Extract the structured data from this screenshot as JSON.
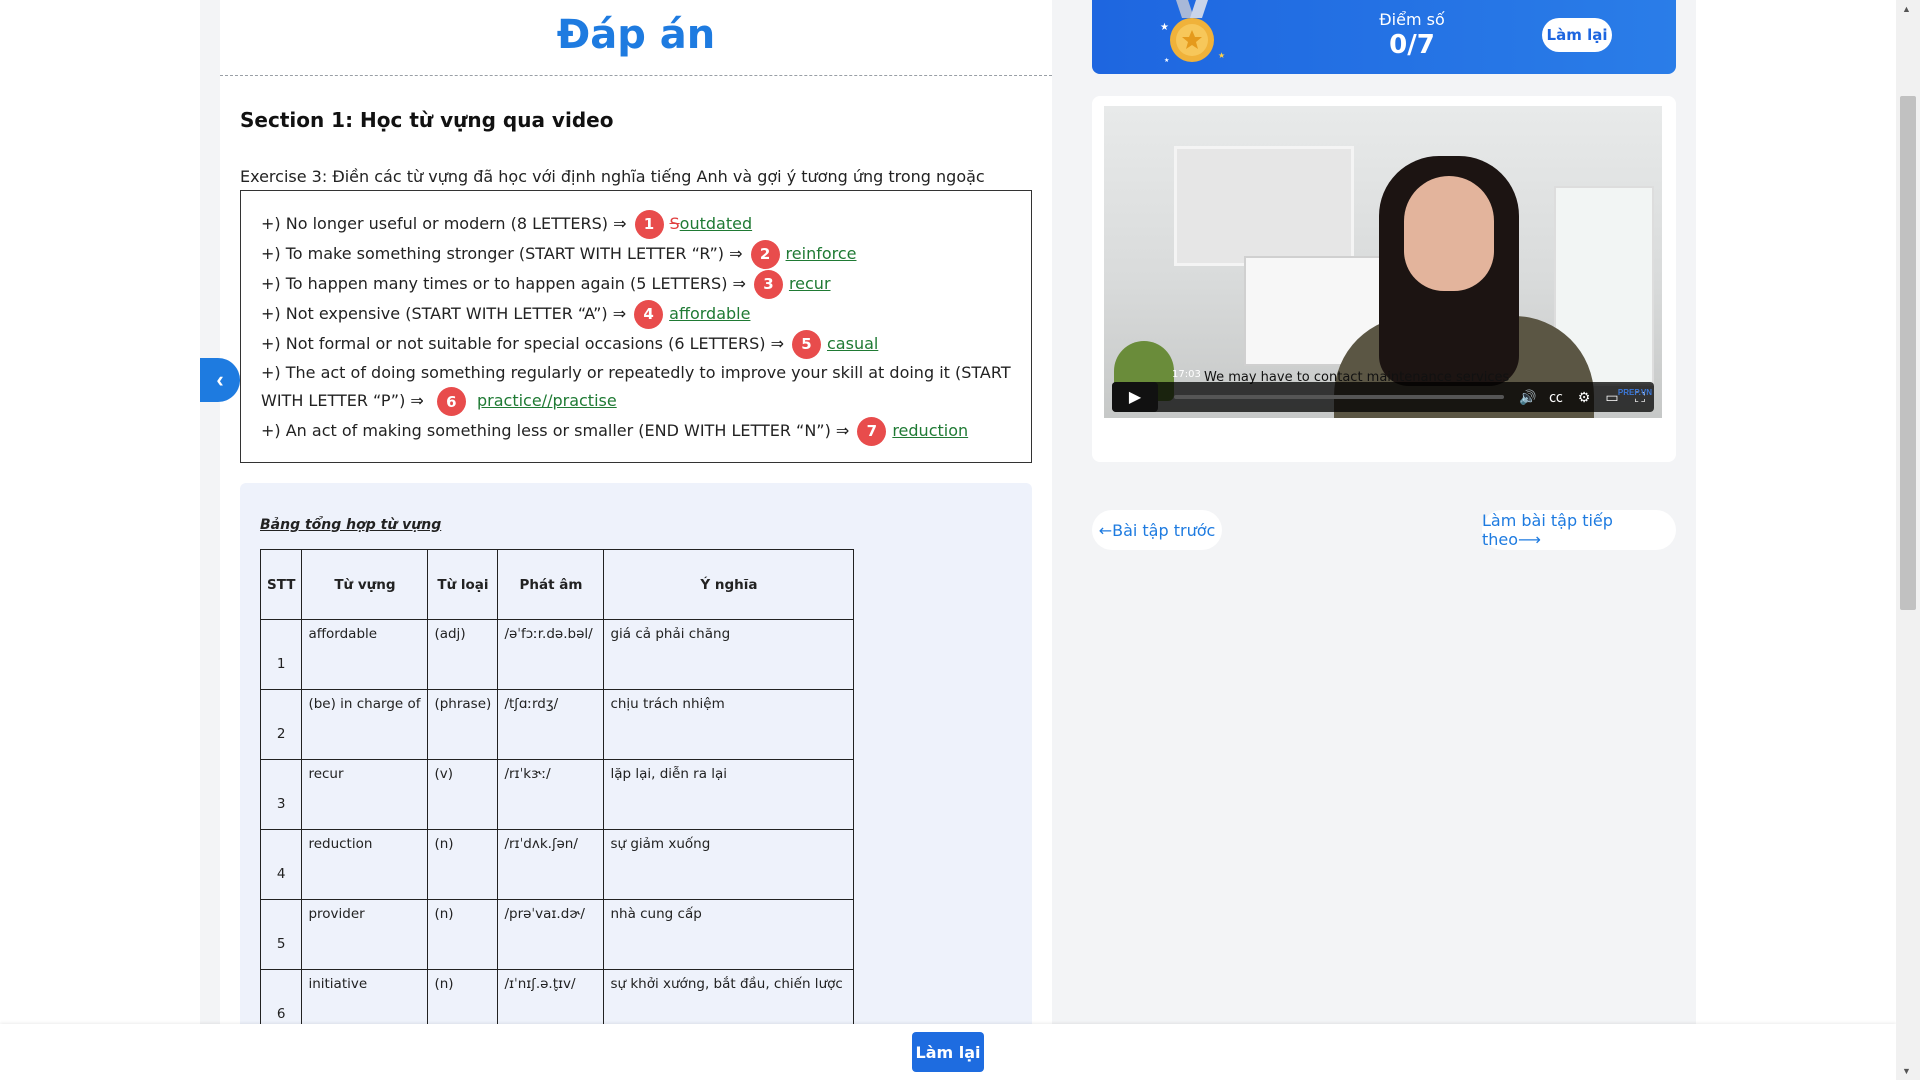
{
  "header": {
    "title": "Đáp án"
  },
  "section": {
    "heading": "Section 1: Học từ vựng qua video",
    "exercise_title": "Exercise 3: Điền các từ vựng đã học với định nghĩa tiếng Anh và gợi ý tương ứng trong ngoặc"
  },
  "questions": [
    {
      "text": "+) No longer useful or modern (8 LETTERS) ⇒",
      "number": "1",
      "wrong": "S",
      "answer": "outdated"
    },
    {
      "text": "+) To make something stronger (START WITH LETTER “R”) ⇒",
      "number": "2",
      "answer": "reinforce"
    },
    {
      "text": "+) To happen many times or to happen again (5 LETTERS) ⇒",
      "number": "3",
      "answer": "recur"
    },
    {
      "text": "+) Not expensive (START WITH LETTER “A”) ⇒",
      "number": "4",
      "answer": "affordable"
    },
    {
      "text": "+) Not formal or not suitable for special occasions (6 LETTERS) ⇒",
      "number": "5",
      "answer": "casual"
    },
    {
      "text": "+) The act of doing something regularly or repeatedly to improve your skill at doing it (START WITH LETTER “P”) ⇒",
      "number": "6",
      "answer": "practice//practise"
    },
    {
      "text": "+) An act of making something less or smaller (END WITH LETTER “N”) ⇒",
      "number": "7",
      "answer": "reduction"
    }
  ],
  "vocab": {
    "title": "Bảng tổng hợp từ vựng",
    "headers": [
      "STT",
      "Từ vựng",
      "Từ loại",
      "Phát âm",
      "Ý nghĩa"
    ],
    "rows": [
      [
        "1",
        "affordable",
        "(adj)",
        "/əˈfɔːr.də.bəl/",
        "giá cả phải chăng"
      ],
      [
        "2",
        "(be) in charge of",
        "(phrase)",
        "/tʃɑːrdʒ/",
        "chịu trách nhiệm"
      ],
      [
        "3",
        "recur",
        "(v)",
        "/rɪˈkɝː/",
        "lặp lại, diễn ra lại"
      ],
      [
        "4",
        "reduction",
        "(n)",
        "/rɪˈdʌk.ʃən/",
        "sự giảm xuống"
      ],
      [
        "5",
        "provider",
        "(n)",
        "/prəˈvaɪ.dɚ/",
        "nhà cung cấp"
      ],
      [
        "6",
        "initiative",
        "(n)",
        "/ɪˈnɪʃ.ə.t̬ɪv/",
        "sự khởi xướng, bắt đầu, chiến lược"
      ]
    ]
  },
  "score": {
    "label": "Điểm số",
    "value": "0/7",
    "retry_label": "Làm lại"
  },
  "video": {
    "timestamp": "17:03",
    "caption": "We may have to contact maintenance services",
    "brand": "PREP.VN",
    "icons": [
      "play-icon",
      "volume-icon",
      "cc-icon",
      "settings-icon",
      "miniplayer-icon",
      "fullscreen-icon"
    ]
  },
  "nav": {
    "prev_label": "←Bài tập trước",
    "next_label": "Làm bài tập tiếp theo⟶"
  },
  "bottom": {
    "retry_label": "Làm lại"
  },
  "colors": {
    "accent": "#1e7be0",
    "badge": "#e84c4c",
    "correct": "#1f7a34",
    "wrong": "#e04040"
  }
}
